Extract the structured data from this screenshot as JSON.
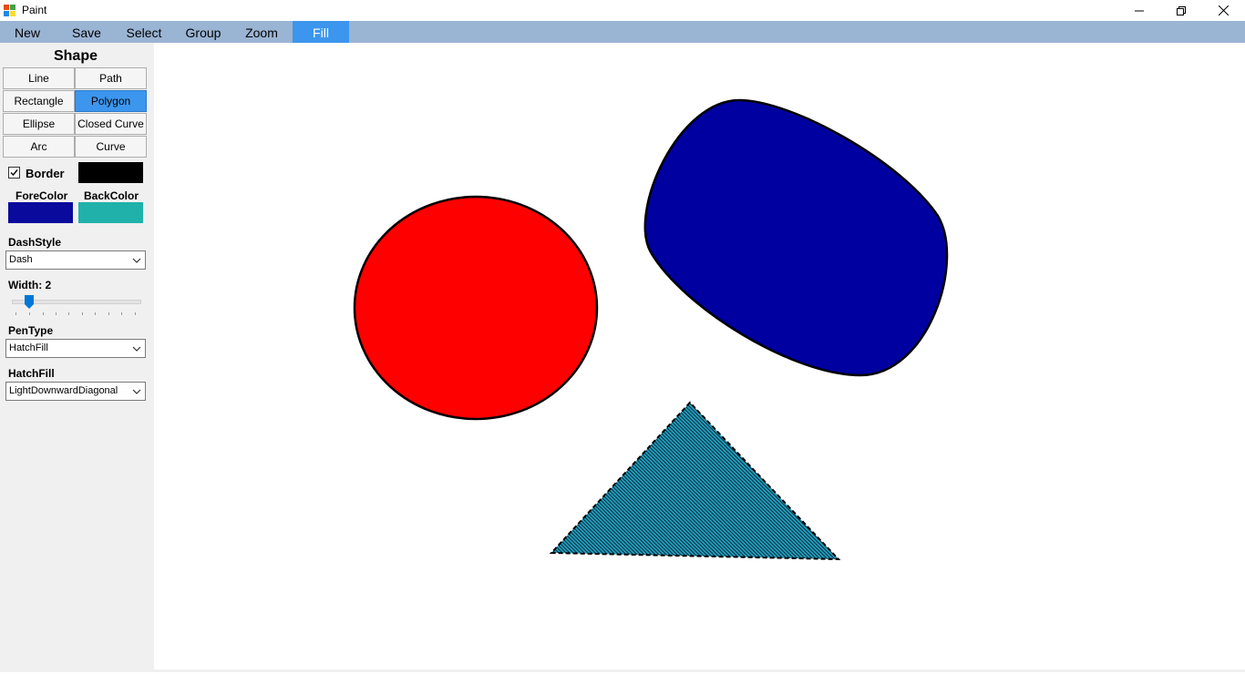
{
  "window": {
    "title": "Paint",
    "controls": [
      "minimize-icon",
      "restore-icon",
      "close-icon"
    ]
  },
  "menu": {
    "items": [
      {
        "label": "New",
        "active": false
      },
      {
        "label": "Save",
        "active": false
      },
      {
        "label": "Select",
        "active": false
      },
      {
        "label": "Group",
        "active": false
      },
      {
        "label": "Zoom",
        "active": false
      },
      {
        "label": "Fill",
        "active": true
      }
    ]
  },
  "panel": {
    "shape_heading": "Shape",
    "shapes": [
      {
        "label": "Line",
        "selected": false
      },
      {
        "label": "Path",
        "selected": false
      },
      {
        "label": "Rectangle",
        "selected": false
      },
      {
        "label": "Polygon",
        "selected": true
      },
      {
        "label": "Ellipse",
        "selected": false
      },
      {
        "label": "Closed Curve",
        "selected": false
      },
      {
        "label": "Arc",
        "selected": false
      },
      {
        "label": "Curve",
        "selected": false
      }
    ],
    "border_label": "Border",
    "border_checked": true,
    "border_color": "#000000",
    "forecolor_label": "ForeColor",
    "backcolor_label": "BackColor",
    "forecolor": "#0a0a9c",
    "backcolor": "#20b2aa",
    "dashstyle_label": "DashStyle",
    "dashstyle_value": "Dash",
    "width_label": "Width: 2",
    "width_value": 2,
    "pentype_label": "PenType",
    "pentype_value": "HatchFill",
    "hatchfill_label": "HatchFill",
    "hatchfill_value": "LightDownwardDiagonal"
  },
  "canvas": {
    "shapes": [
      {
        "kind": "ellipse",
        "fill": "#ff0000",
        "stroke": "#000000"
      },
      {
        "kind": "closed-curve",
        "fill": "#0000a0",
        "stroke": "#000000"
      },
      {
        "kind": "polygon-triangle",
        "fill": "#20a0c0",
        "hatch": "#0a2a3a",
        "stroke": "#000000",
        "dash": "Dash"
      }
    ]
  }
}
